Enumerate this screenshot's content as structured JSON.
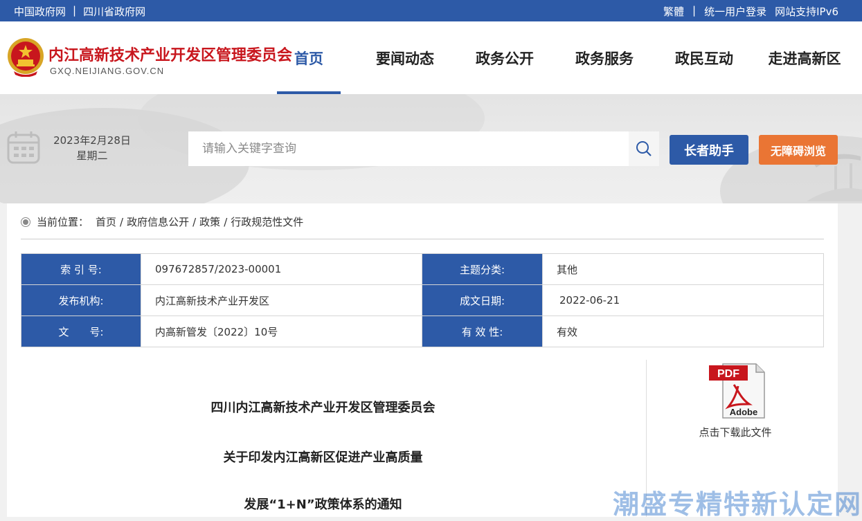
{
  "topbar": {
    "left_links": [
      "中国政府网",
      "四川省政府网"
    ],
    "right_links": [
      "繁體",
      "统一用户登录",
      "网站支持IPv6"
    ]
  },
  "header": {
    "site_name": "内江高新技术产业开发区管理委员会",
    "site_domain": "GXQ.NEIJIANG.GOV.CN",
    "nav": [
      "首页",
      "要闻动态",
      "政务公开",
      "政务服务",
      "政民互动",
      "走进高新区"
    ],
    "active_nav": "首页"
  },
  "banner": {
    "date": "2023年2月28日",
    "weekday": "星期二",
    "search_placeholder": "请输入关键字查询",
    "elder_button": "长者助手",
    "access_button": "无障碍浏览"
  },
  "breadcrumb": {
    "prefix": "当前位置：",
    "items": [
      "首页",
      "政府信息公开",
      "政策",
      "行政规范性文件"
    ]
  },
  "meta": {
    "index_label": "索 引 号:",
    "index_value": "097672857/2023-00001",
    "topic_label": "主题分类:",
    "topic_value": "其他",
    "org_label": "发布机构:",
    "org_value": "内江高新技术产业开发区",
    "date_label": "成文日期:",
    "date_value": "2022-06-21",
    "docno_label": "文　　号:",
    "docno_value": "内高新管发〔2022〕10号",
    "validity_label": "有 效 性:",
    "validity_value": "有效"
  },
  "document": {
    "title_line1": "四川内江高新技术产业开发区管理委员会",
    "title_line2": "关于印发内江高新区促进产业高质量",
    "title_line3": "发展“1+N”政策体系的通知"
  },
  "download": {
    "pdf_text": "PDF",
    "adobe_text": "Adobe",
    "label": "点击下载此文件"
  },
  "watermark": "潮盛专精特新认定网",
  "colors": {
    "primary_blue": "#2d5aa7",
    "accent_orange": "#ea7534",
    "brand_red": "#c8161d"
  }
}
